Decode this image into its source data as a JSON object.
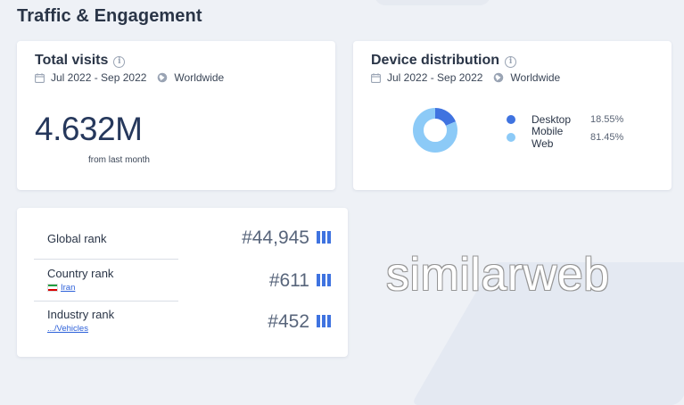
{
  "section": {
    "title": "Traffic & Engagement"
  },
  "total_visits": {
    "title": "Total visits",
    "date_range": "Jul 2022 - Sep 2022",
    "region": "Worldwide",
    "value": "4.632M",
    "caption": "from last month"
  },
  "device_distribution": {
    "title": "Device distribution",
    "date_range": "Jul 2022 - Sep 2022",
    "region": "Worldwide",
    "items": [
      {
        "label": "Desktop",
        "value": "18.55%",
        "fraction": 0.1855,
        "color": "#3f73e0"
      },
      {
        "label": "Mobile Web",
        "value": "81.45%",
        "fraction": 0.8145,
        "color": "#8ccaf7"
      }
    ]
  },
  "ranks": [
    {
      "label": "Global rank",
      "value": "#44,945",
      "sub": ""
    },
    {
      "label": "Country rank",
      "value": "#611",
      "sub": "Iran"
    },
    {
      "label": "Industry rank",
      "value": "#452",
      "sub": ".../Vehicles"
    }
  ],
  "watermark": "similarweb",
  "colors": {
    "accent": "#3f73e0",
    "link": "#2b5fd9",
    "text": "#2a3547"
  }
}
